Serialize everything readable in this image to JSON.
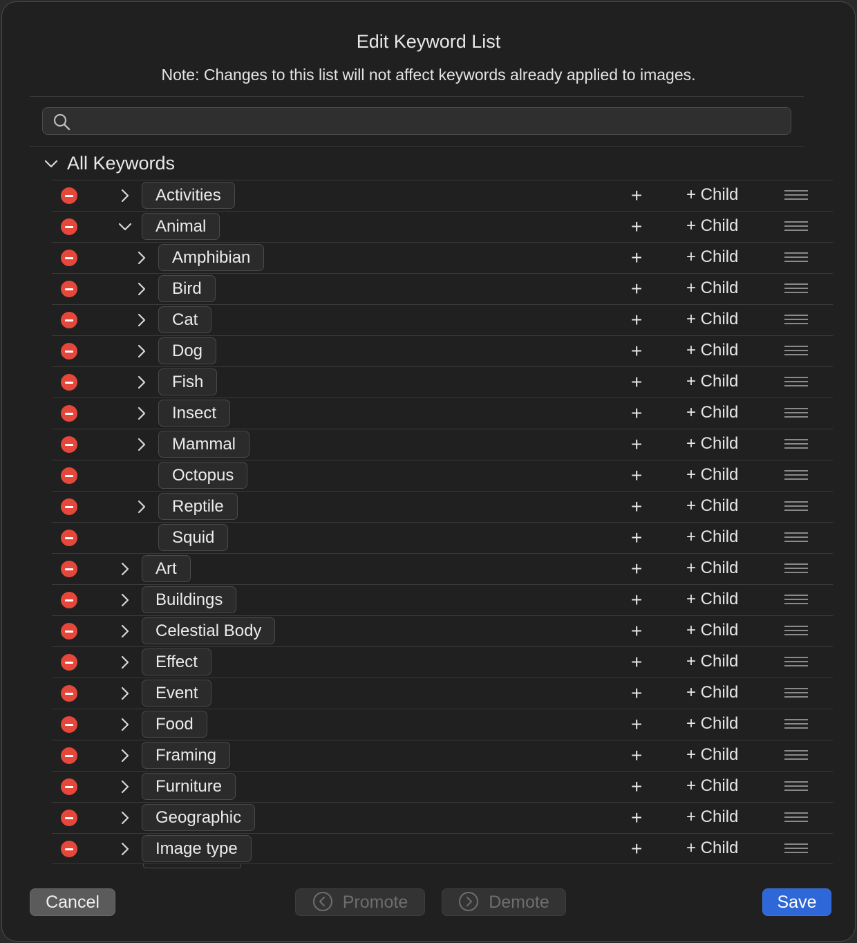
{
  "dialog": {
    "title": "Edit Keyword List",
    "note": "Note: Changes to this list will not affect keywords already applied to images."
  },
  "search": {
    "placeholder": "",
    "value": "",
    "icon": "search-icon"
  },
  "root": {
    "label": "All Keywords",
    "expanded": true
  },
  "row_actions": {
    "add_label": "+",
    "add_child_label": "+ Child"
  },
  "keywords": [
    {
      "label": "Activities",
      "level": 0,
      "expandable": true,
      "expanded": false
    },
    {
      "label": "Animal",
      "level": 0,
      "expandable": true,
      "expanded": true
    },
    {
      "label": "Amphibian",
      "level": 1,
      "expandable": true,
      "expanded": false
    },
    {
      "label": "Bird",
      "level": 1,
      "expandable": true,
      "expanded": false
    },
    {
      "label": "Cat",
      "level": 1,
      "expandable": true,
      "expanded": false
    },
    {
      "label": "Dog",
      "level": 1,
      "expandable": true,
      "expanded": false
    },
    {
      "label": "Fish",
      "level": 1,
      "expandable": true,
      "expanded": false
    },
    {
      "label": "Insect",
      "level": 1,
      "expandable": true,
      "expanded": false
    },
    {
      "label": "Mammal",
      "level": 1,
      "expandable": true,
      "expanded": false
    },
    {
      "label": "Octopus",
      "level": 1,
      "expandable": false,
      "expanded": false
    },
    {
      "label": "Reptile",
      "level": 1,
      "expandable": true,
      "expanded": false
    },
    {
      "label": "Squid",
      "level": 1,
      "expandable": false,
      "expanded": false
    },
    {
      "label": "Art",
      "level": 0,
      "expandable": true,
      "expanded": false
    },
    {
      "label": "Buildings",
      "level": 0,
      "expandable": true,
      "expanded": false
    },
    {
      "label": "Celestial Body",
      "level": 0,
      "expandable": true,
      "expanded": false
    },
    {
      "label": "Effect",
      "level": 0,
      "expandable": true,
      "expanded": false
    },
    {
      "label": "Event",
      "level": 0,
      "expandable": true,
      "expanded": false
    },
    {
      "label": "Food",
      "level": 0,
      "expandable": true,
      "expanded": false
    },
    {
      "label": "Framing",
      "level": 0,
      "expandable": true,
      "expanded": false
    },
    {
      "label": "Furniture",
      "level": 0,
      "expandable": true,
      "expanded": false
    },
    {
      "label": "Geographic",
      "level": 0,
      "expandable": true,
      "expanded": false
    },
    {
      "label": "Image type",
      "level": 0,
      "expandable": true,
      "expanded": false
    }
  ],
  "footer": {
    "cancel_label": "Cancel",
    "promote_label": "Promote",
    "demote_label": "Demote",
    "save_label": "Save"
  },
  "colors": {
    "background": "#202020",
    "delete": "#e5483b",
    "save": "#2d67d8",
    "text": "#e6e6e6"
  }
}
